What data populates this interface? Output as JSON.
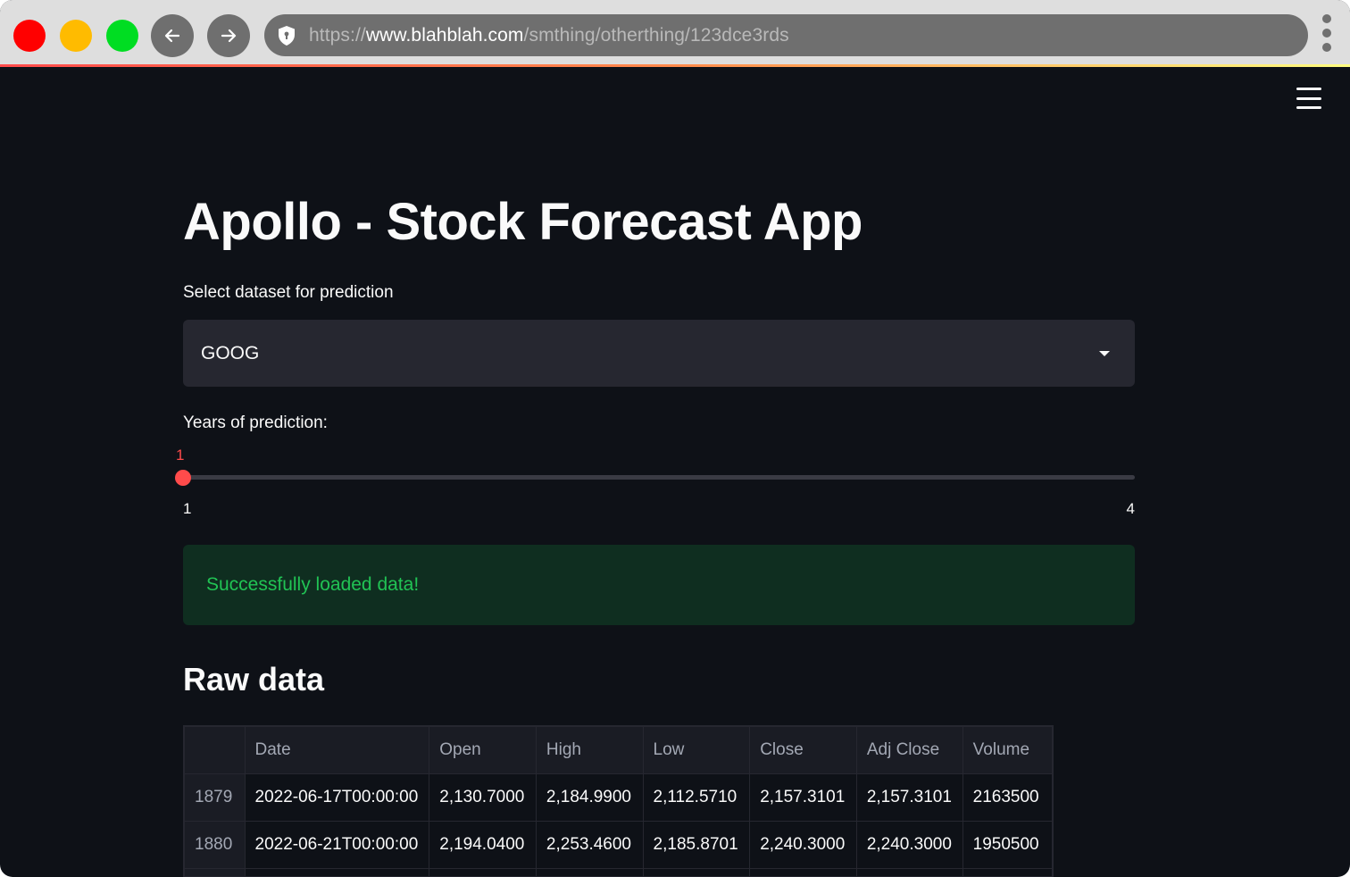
{
  "browser": {
    "url_scheme": "https://",
    "url_host": "www.blahblah.com",
    "url_path": "/smthing/otherthing/123dce3rds"
  },
  "app": {
    "title": "Apollo - Stock Forecast App",
    "dataset_label": "Select dataset for prediction",
    "dataset_selected": "GOOG",
    "years_label": "Years of prediction:",
    "years_value": "1",
    "years_min": "1",
    "years_max": "4",
    "status_message": "Successfully loaded data!",
    "raw_data_header": "Raw data"
  },
  "table": {
    "columns": [
      "",
      "Date",
      "Open",
      "High",
      "Low",
      "Close",
      "Adj Close",
      "Volume"
    ],
    "rows": [
      [
        "1879",
        "2022-06-17T00:00:00",
        "2,130.7000",
        "2,184.9900",
        "2,112.5710",
        "2,157.3101",
        "2,157.3101",
        "2163500"
      ],
      [
        "1880",
        "2022-06-21T00:00:00",
        "2,194.0400",
        "2,253.4600",
        "2,185.8701",
        "2,240.3000",
        "2,240.3000",
        "1950500"
      ],
      [
        "",
        "",
        "",
        "",
        "",
        "",
        "",
        ""
      ]
    ]
  },
  "colors": {
    "background": "#0e1117",
    "accent": "#ff4b4b",
    "success_text": "#21c354",
    "success_bg": "#0f2e20",
    "select_bg": "#262730"
  },
  "icons": {
    "back": "arrow-left-icon",
    "forward": "arrow-right-icon",
    "security": "shield-icon",
    "menu": "hamburger-menu-icon",
    "browser_menu": "kebab-menu-icon",
    "dropdown": "caret-down-icon"
  }
}
